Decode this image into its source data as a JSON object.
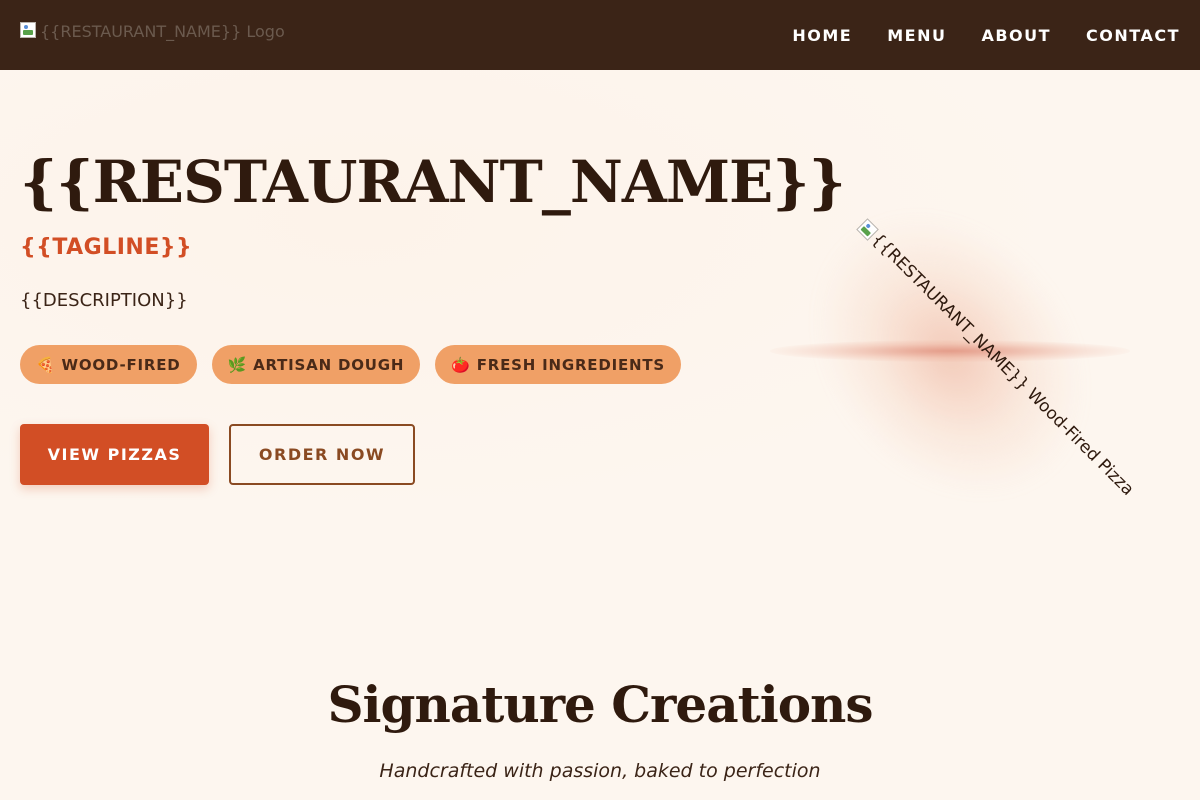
{
  "nav": {
    "logo_alt": "{{RESTAURANT_NAME}} Logo",
    "links": [
      {
        "label": "HOME",
        "icon": ""
      },
      {
        "label": "MENU",
        "icon": ""
      },
      {
        "label": "ABOUT",
        "icon": ""
      },
      {
        "label": "CONTACT",
        "icon": ""
      }
    ]
  },
  "hero": {
    "title": "{{RESTAURANT_NAME}}",
    "tagline": "{{TAGLINE}}",
    "description": "{{DESCRIPTION}}",
    "badges": [
      {
        "emoji": "🍕",
        "label": "WOOD-FIRED"
      },
      {
        "emoji": "🌿",
        "label": "ARTISAN DOUGH"
      },
      {
        "emoji": "🍅",
        "label": "FRESH INGREDIENTS"
      }
    ],
    "primary_button": "VIEW PIZZAS",
    "secondary_button": "ORDER NOW",
    "image_alt": "{{RESTAURANT_NAME}} Wood-Fired Pizza"
  },
  "signature": {
    "title": "Signature Creations",
    "subtitle": "Handcrafted with passion, baked to perfection"
  },
  "colors": {
    "nav_bg": "#3b2417",
    "page_bg": "#fdf6ef",
    "accent": "#d24e25",
    "badge_bg": "#f0a066",
    "outline_button": "#8a4a22",
    "heading": "#2f1a0e"
  }
}
